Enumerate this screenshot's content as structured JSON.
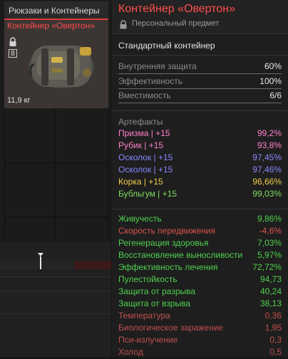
{
  "inventory": {
    "category_label": "Рюкзаки и Контейнеры",
    "item_title": "Контейнер «Овертон»",
    "slot_count": "8",
    "weight": "11,9 кг",
    "icons": {
      "lock": "lock-icon",
      "item": "backpack-container-icon"
    }
  },
  "panel": {
    "title": "Контейнер «Овертон»",
    "subtitle": "Персональный предмет",
    "item_type": "Стандартный контейнер",
    "stats": [
      {
        "label": "Внутренняя защита",
        "value": "60%"
      },
      {
        "label": "Эффективность",
        "value": "100%"
      },
      {
        "label": "Вместимость",
        "value": "6/6"
      }
    ],
    "artifacts_header": "Артефакты",
    "artifacts": [
      {
        "name": "Призма | +15",
        "value": "99,2%",
        "color": "#ff7fc9"
      },
      {
        "name": "Рубик | +15",
        "value": "93,8%",
        "color": "#ff7fc9"
      },
      {
        "name": "Осколок | +15",
        "value": "97,45%",
        "color": "#8a87ff"
      },
      {
        "name": "Осколок | +15",
        "value": "97,46%",
        "color": "#8a87ff"
      },
      {
        "name": "Корка | +15",
        "value": "96,66%",
        "color": "#f0cc4a"
      },
      {
        "name": "Бубльгум | +15",
        "value": "99,03%",
        "color": "#7fdc5e"
      }
    ],
    "effects": [
      {
        "label": "Живучесть",
        "value": "9,86%",
        "color": "#4fd14f"
      },
      {
        "label": "Скорость передвижения",
        "value": "-4,6%",
        "color": "#d9534f"
      },
      {
        "label": "Регенерация здоровья",
        "value": "7,03%",
        "color": "#4fd14f"
      },
      {
        "label": "Восстановление выносливости",
        "value": "5,97%",
        "color": "#4fd14f"
      },
      {
        "label": "Эффективность лечения",
        "value": "72,72%",
        "color": "#4fd14f"
      },
      {
        "label": "Пулестойкость",
        "value": "94,73",
        "color": "#4fd14f"
      },
      {
        "label": "Защита от разрыва",
        "value": "40,24",
        "color": "#4fd14f"
      },
      {
        "label": "Защита от взрыва",
        "value": "38,13",
        "color": "#4fd14f"
      },
      {
        "label": "Температура",
        "value": "0,36",
        "color": "#c0504d"
      },
      {
        "label": "Биологическое заражение",
        "value": "1,95",
        "color": "#c0504d"
      },
      {
        "label": "Пси-излучение",
        "value": "0,3",
        "color": "#c0504d"
      },
      {
        "label": "Холод",
        "value": "0,5",
        "color": "#c0504d"
      }
    ]
  },
  "colors": {
    "accent_red": "#ff4d4d",
    "positive": "#4fd14f",
    "negative": "#d9534f"
  }
}
